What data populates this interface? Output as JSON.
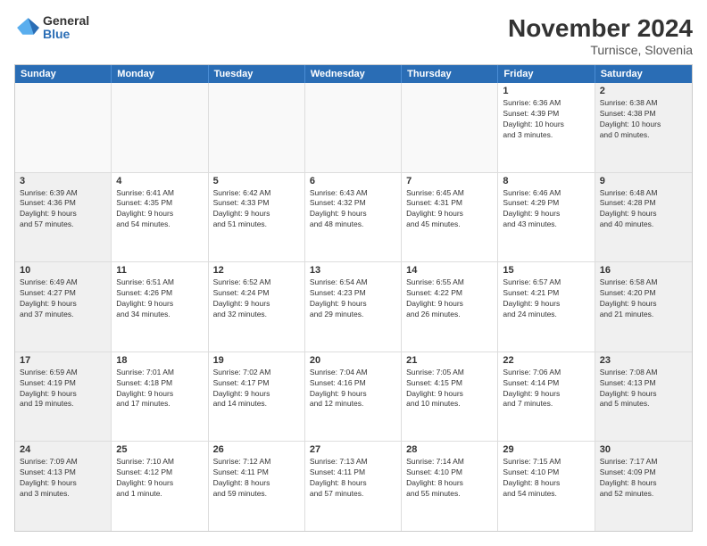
{
  "logo": {
    "general": "General",
    "blue": "Blue"
  },
  "title": "November 2024",
  "location": "Turnisce, Slovenia",
  "header_days": [
    "Sunday",
    "Monday",
    "Tuesday",
    "Wednesday",
    "Thursday",
    "Friday",
    "Saturday"
  ],
  "weeks": [
    [
      {
        "day": "",
        "info": ""
      },
      {
        "day": "",
        "info": ""
      },
      {
        "day": "",
        "info": ""
      },
      {
        "day": "",
        "info": ""
      },
      {
        "day": "",
        "info": ""
      },
      {
        "day": "1",
        "info": "Sunrise: 6:36 AM\nSunset: 4:39 PM\nDaylight: 10 hours\nand 3 minutes."
      },
      {
        "day": "2",
        "info": "Sunrise: 6:38 AM\nSunset: 4:38 PM\nDaylight: 10 hours\nand 0 minutes."
      }
    ],
    [
      {
        "day": "3",
        "info": "Sunrise: 6:39 AM\nSunset: 4:36 PM\nDaylight: 9 hours\nand 57 minutes."
      },
      {
        "day": "4",
        "info": "Sunrise: 6:41 AM\nSunset: 4:35 PM\nDaylight: 9 hours\nand 54 minutes."
      },
      {
        "day": "5",
        "info": "Sunrise: 6:42 AM\nSunset: 4:33 PM\nDaylight: 9 hours\nand 51 minutes."
      },
      {
        "day": "6",
        "info": "Sunrise: 6:43 AM\nSunset: 4:32 PM\nDaylight: 9 hours\nand 48 minutes."
      },
      {
        "day": "7",
        "info": "Sunrise: 6:45 AM\nSunset: 4:31 PM\nDaylight: 9 hours\nand 45 minutes."
      },
      {
        "day": "8",
        "info": "Sunrise: 6:46 AM\nSunset: 4:29 PM\nDaylight: 9 hours\nand 43 minutes."
      },
      {
        "day": "9",
        "info": "Sunrise: 6:48 AM\nSunset: 4:28 PM\nDaylight: 9 hours\nand 40 minutes."
      }
    ],
    [
      {
        "day": "10",
        "info": "Sunrise: 6:49 AM\nSunset: 4:27 PM\nDaylight: 9 hours\nand 37 minutes."
      },
      {
        "day": "11",
        "info": "Sunrise: 6:51 AM\nSunset: 4:26 PM\nDaylight: 9 hours\nand 34 minutes."
      },
      {
        "day": "12",
        "info": "Sunrise: 6:52 AM\nSunset: 4:24 PM\nDaylight: 9 hours\nand 32 minutes."
      },
      {
        "day": "13",
        "info": "Sunrise: 6:54 AM\nSunset: 4:23 PM\nDaylight: 9 hours\nand 29 minutes."
      },
      {
        "day": "14",
        "info": "Sunrise: 6:55 AM\nSunset: 4:22 PM\nDaylight: 9 hours\nand 26 minutes."
      },
      {
        "day": "15",
        "info": "Sunrise: 6:57 AM\nSunset: 4:21 PM\nDaylight: 9 hours\nand 24 minutes."
      },
      {
        "day": "16",
        "info": "Sunrise: 6:58 AM\nSunset: 4:20 PM\nDaylight: 9 hours\nand 21 minutes."
      }
    ],
    [
      {
        "day": "17",
        "info": "Sunrise: 6:59 AM\nSunset: 4:19 PM\nDaylight: 9 hours\nand 19 minutes."
      },
      {
        "day": "18",
        "info": "Sunrise: 7:01 AM\nSunset: 4:18 PM\nDaylight: 9 hours\nand 17 minutes."
      },
      {
        "day": "19",
        "info": "Sunrise: 7:02 AM\nSunset: 4:17 PM\nDaylight: 9 hours\nand 14 minutes."
      },
      {
        "day": "20",
        "info": "Sunrise: 7:04 AM\nSunset: 4:16 PM\nDaylight: 9 hours\nand 12 minutes."
      },
      {
        "day": "21",
        "info": "Sunrise: 7:05 AM\nSunset: 4:15 PM\nDaylight: 9 hours\nand 10 minutes."
      },
      {
        "day": "22",
        "info": "Sunrise: 7:06 AM\nSunset: 4:14 PM\nDaylight: 9 hours\nand 7 minutes."
      },
      {
        "day": "23",
        "info": "Sunrise: 7:08 AM\nSunset: 4:13 PM\nDaylight: 9 hours\nand 5 minutes."
      }
    ],
    [
      {
        "day": "24",
        "info": "Sunrise: 7:09 AM\nSunset: 4:13 PM\nDaylight: 9 hours\nand 3 minutes."
      },
      {
        "day": "25",
        "info": "Sunrise: 7:10 AM\nSunset: 4:12 PM\nDaylight: 9 hours\nand 1 minute."
      },
      {
        "day": "26",
        "info": "Sunrise: 7:12 AM\nSunset: 4:11 PM\nDaylight: 8 hours\nand 59 minutes."
      },
      {
        "day": "27",
        "info": "Sunrise: 7:13 AM\nSunset: 4:11 PM\nDaylight: 8 hours\nand 57 minutes."
      },
      {
        "day": "28",
        "info": "Sunrise: 7:14 AM\nSunset: 4:10 PM\nDaylight: 8 hours\nand 55 minutes."
      },
      {
        "day": "29",
        "info": "Sunrise: 7:15 AM\nSunset: 4:10 PM\nDaylight: 8 hours\nand 54 minutes."
      },
      {
        "day": "30",
        "info": "Sunrise: 7:17 AM\nSunset: 4:09 PM\nDaylight: 8 hours\nand 52 minutes."
      }
    ]
  ]
}
